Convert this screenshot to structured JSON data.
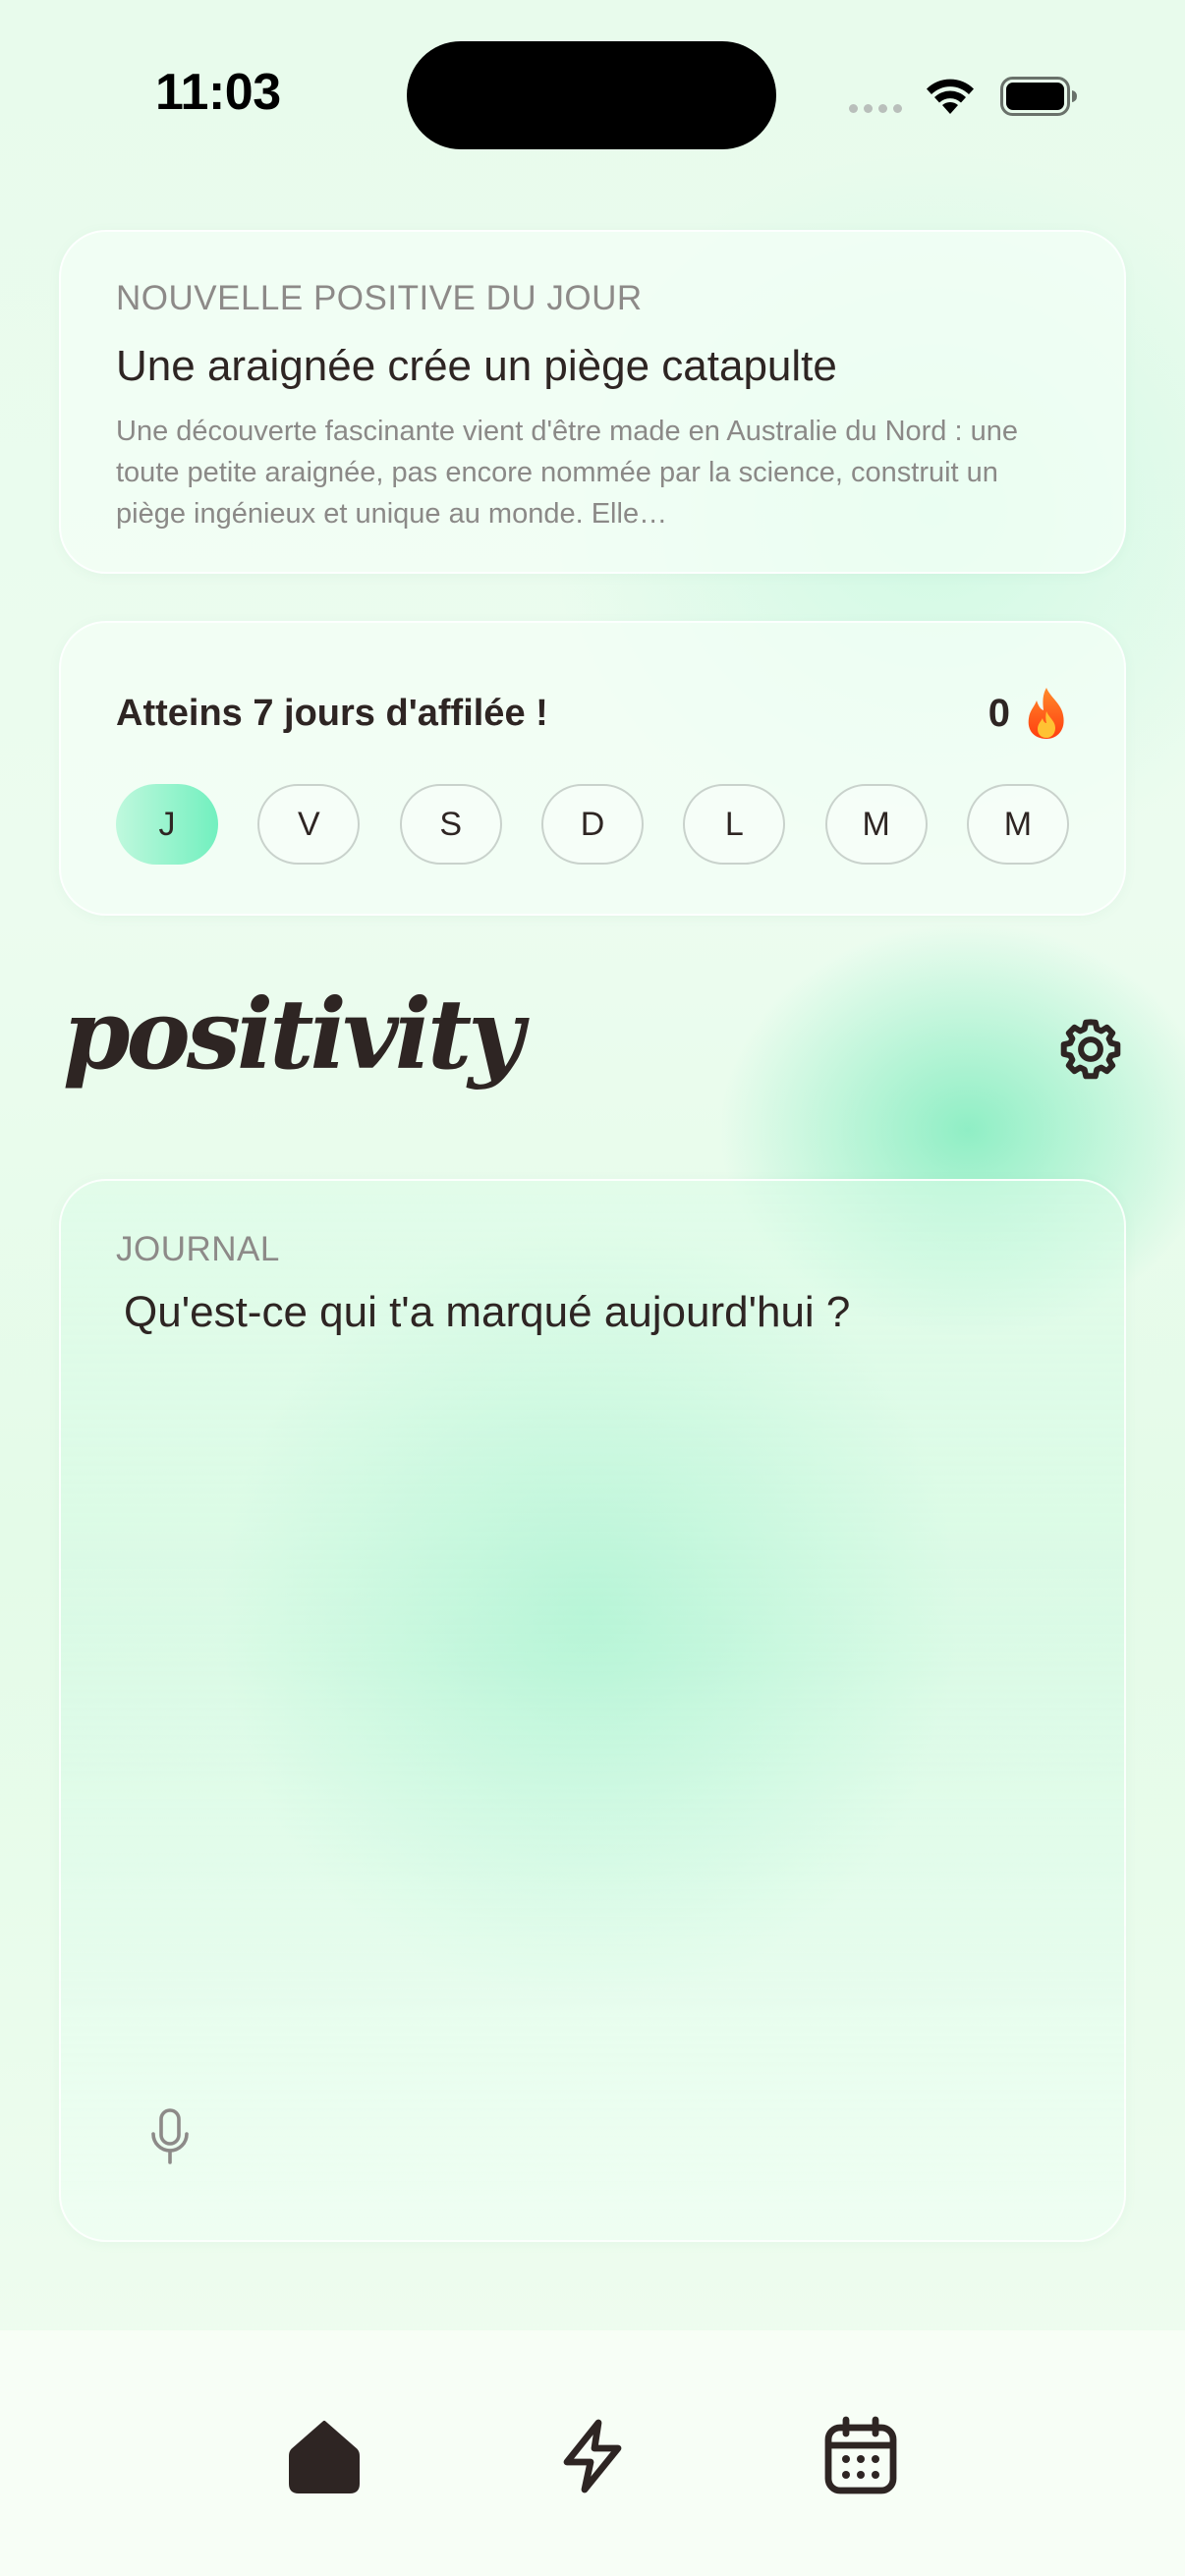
{
  "status_bar": {
    "time": "11:03"
  },
  "news": {
    "eyebrow": "NOUVELLE POSITIVE DU JOUR",
    "title": "Une araignée crée un piège catapulte",
    "summary": "Une découverte fascinante vient d'être made en Australie du Nord : une toute petite araignée, pas encore nommée par la science, construit un piège ingénieux et unique au monde. Elle…"
  },
  "streak": {
    "label": "Atteins 7 jours d'affilée !",
    "count": "0",
    "icon": "fire-icon",
    "days": [
      {
        "label": "J",
        "active": true
      },
      {
        "label": "V",
        "active": false
      },
      {
        "label": "S",
        "active": false
      },
      {
        "label": "D",
        "active": false
      },
      {
        "label": "L",
        "active": false
      },
      {
        "label": "M",
        "active": false
      },
      {
        "label": "M",
        "active": false
      }
    ]
  },
  "brand": {
    "logo": "positivity"
  },
  "journal": {
    "eyebrow": "JOURNAL",
    "placeholder": "Qu'est-ce qui t'a marqué aujourd'hui ?",
    "value": ""
  },
  "tabs": [
    {
      "icon": "home-icon",
      "selected": true
    },
    {
      "icon": "lightning-icon",
      "selected": false
    },
    {
      "icon": "calendar-icon",
      "selected": false
    }
  ],
  "colors": {
    "text_primary": "#2e2523",
    "text_muted": "#8d8a88",
    "accent_mint": "#72f0bf",
    "fire": "#ff5a1f"
  }
}
